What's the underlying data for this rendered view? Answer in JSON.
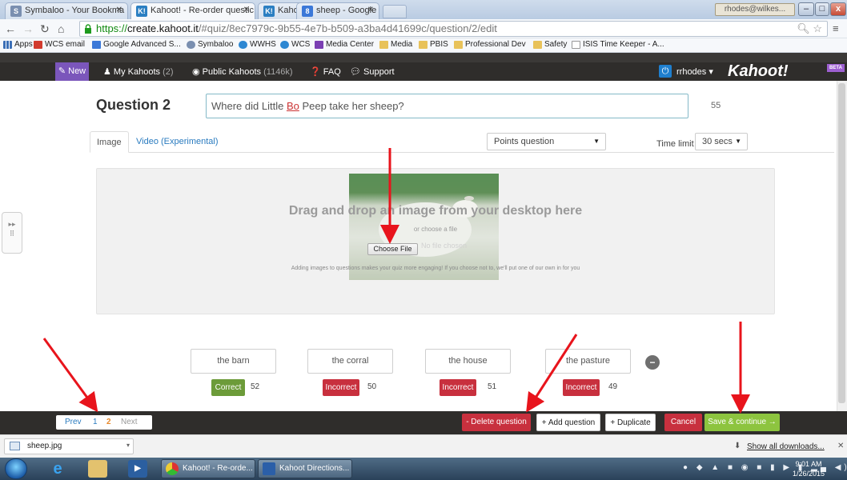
{
  "browser": {
    "tabs": [
      {
        "title": "Symbaloo - Your Bookma",
        "active": false
      },
      {
        "title": "Kahoot! - Re-order questic",
        "active": true
      },
      {
        "title": "Kahoot! - Create new Kah",
        "active": false
      },
      {
        "title": "sheep - Google Search",
        "active": false
      }
    ],
    "user_badge": "rhodes@wilkes...",
    "url_scheme": "https://",
    "url_host": "create.kahoot.it",
    "url_rest": "/#quiz/8ec7979c-9b55-4e7b-b509-a3ba4d41699c/question/2/edit",
    "bookmarks": [
      "Apps",
      "WCS email",
      "Google Advanced S...",
      "Symbaloo",
      "WWHS",
      "WCS",
      "Media Center",
      "Media",
      "PBIS",
      "Professional Dev",
      "Safety",
      "ISIS Time Keeper - A..."
    ]
  },
  "kahoot_nav": {
    "new_label": "New K!",
    "my_kahoots_label": "My Kahoots",
    "my_kahoots_count": "(2)",
    "public_label": "Public Kahoots",
    "public_count": "(1146k)",
    "faq_label": "FAQ",
    "support_label": "Support",
    "user_label": "rrhodes",
    "logo": "Kahoot!",
    "beta": "BETA"
  },
  "question": {
    "label": "Question 2",
    "text_before": "Where did Little ",
    "text_bo": "Bo",
    "text_after": " Peep take her sheep?",
    "char_count": "55"
  },
  "media_tabs": {
    "image": "Image",
    "video": "Video (Experimental)"
  },
  "question_type": "Points question",
  "time_limit_label": "Time limit",
  "time_limit_value": "30 secs",
  "dropzone": {
    "title": "Drag and drop an image from your desktop here",
    "or": "or choose a file",
    "choose_file": "Choose File",
    "no_file": "No file chosen",
    "hint": "Adding images to questions makes your quiz more engaging! If you choose not to, we'll put one of our own in for you"
  },
  "answers": [
    {
      "text": "the barn",
      "status": "Correct",
      "count": "52"
    },
    {
      "text": "the corral",
      "status": "Incorrect",
      "count": "50"
    },
    {
      "text": "the house",
      "status": "Incorrect",
      "count": "51"
    },
    {
      "text": "the pasture",
      "status": "Incorrect",
      "count": "49"
    }
  ],
  "footer": {
    "prev": "Prev",
    "page1": "1",
    "page2": "2",
    "next": "Next",
    "delete": "- Delete question",
    "add": "+ Add question",
    "duplicate": "+ Duplicate",
    "cancel": "Cancel",
    "save": "Save & continue →"
  },
  "downloads": {
    "file": "sheep.jpg",
    "show_all": "Show all downloads..."
  },
  "taskbar": {
    "task1": "Kahoot! - Re-orde...",
    "task2": "Kahoot Directions...",
    "time": "9:01 AM",
    "date": "1/26/2015"
  },
  "colors": {
    "kahoot_nav": "#2f2d2b",
    "new_button": "#7b56bb",
    "correct": "#6c9b39",
    "incorrect": "#c8303e",
    "save": "#8dc43f",
    "annotation_arrow": "#e8141c"
  }
}
